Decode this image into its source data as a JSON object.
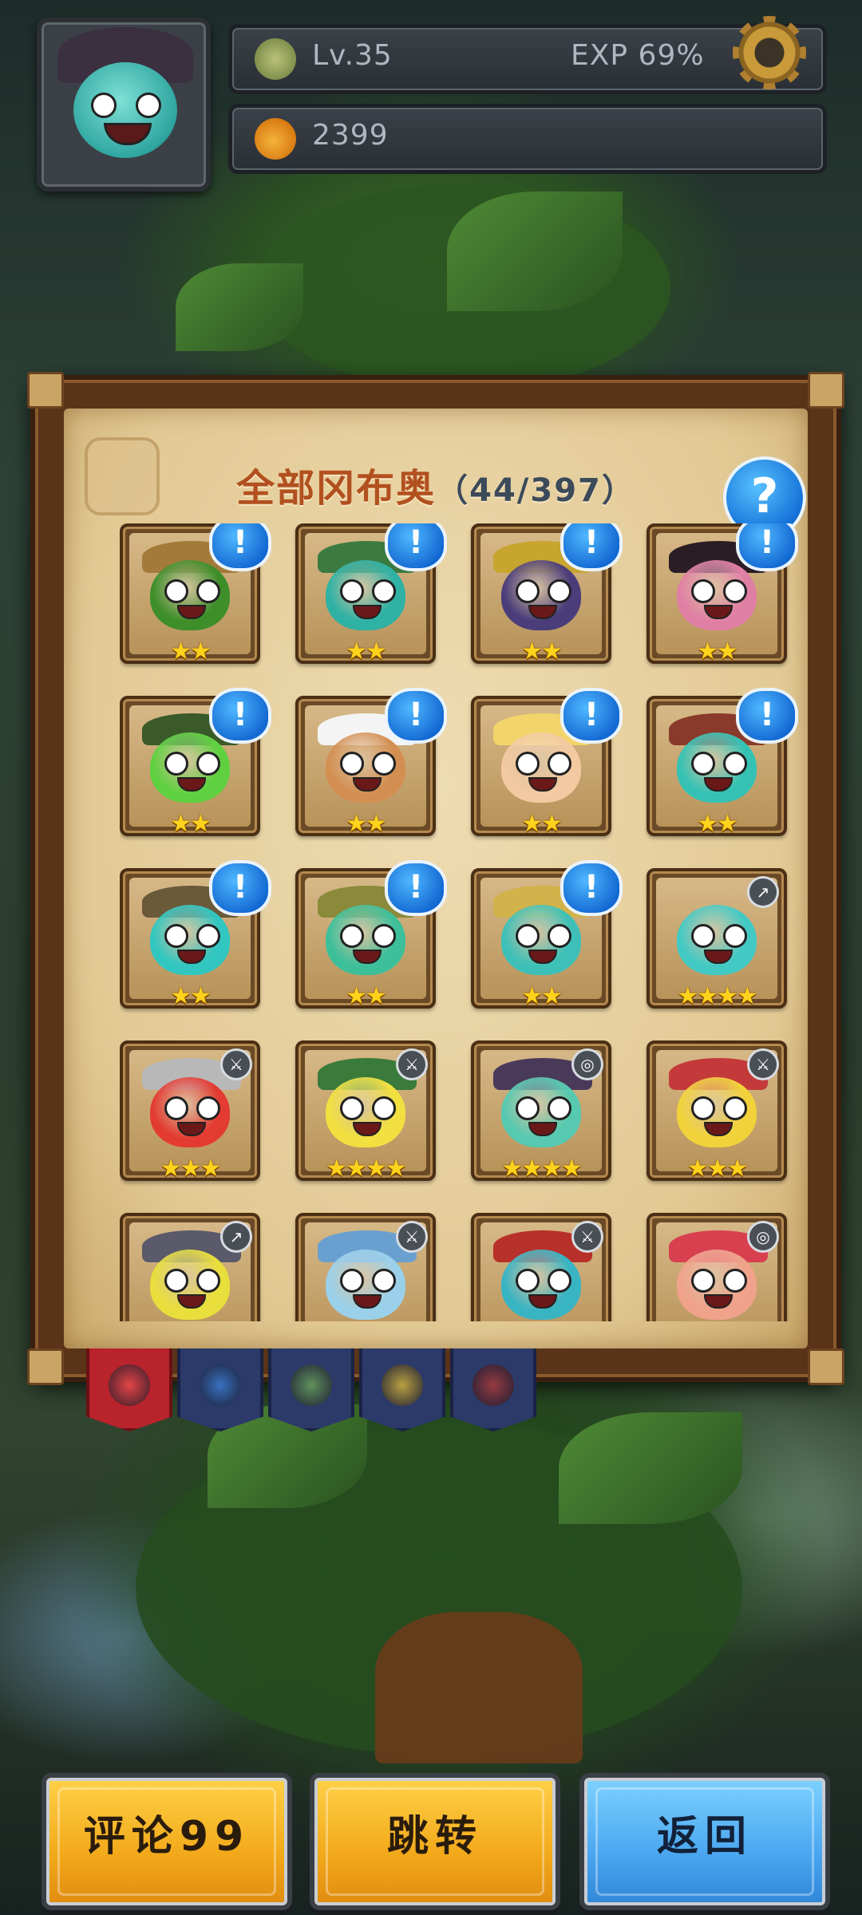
{
  "player": {
    "level": "Lv.35",
    "exp_label": "EXP 69%",
    "exp_percent": 69,
    "currency": "2399"
  },
  "collection": {
    "title": "全部冈布奥",
    "count": "（44/397）",
    "help_label": "?",
    "rows": [
      [
        {
          "name": "cactus-cowboy",
          "stars": "★★",
          "badge": "!",
          "body": "#3e8e2a",
          "hat": "#a37a3a"
        },
        {
          "name": "green-goggles",
          "stars": "★★",
          "badge": "!",
          "body": "#2fb1a4",
          "hat": "#3b7a40"
        },
        {
          "name": "robot-pilot",
          "stars": "★★",
          "badge": "!",
          "body": "#4a3d7a",
          "hat": "#c7a52e"
        },
        {
          "name": "samurai-girl",
          "stars": "★★",
          "badge": "!",
          "body": "#e07fa4",
          "hat": "#2a1d24"
        }
      ],
      [
        {
          "name": "tank-commander",
          "stars": "★★",
          "badge": "!",
          "body": "#5fd040",
          "hat": "#3a5a2a"
        },
        {
          "name": "chef",
          "stars": "★★",
          "badge": "!",
          "body": "#d38f52",
          "hat": "#f4f4f4"
        },
        {
          "name": "blond-knight",
          "stars": "★★",
          "badge": "!",
          "body": "#f2c9a0",
          "hat": "#f2d46a"
        },
        {
          "name": "elf-gunner",
          "stars": "★★",
          "badge": "!",
          "body": "#35c2b4",
          "hat": "#8a3a2a"
        }
      ],
      [
        {
          "name": "engineer",
          "stars": "★★",
          "badge": "!",
          "body": "#31c6c0",
          "hat": "#6a5a3a"
        },
        {
          "name": "gardener",
          "stars": "★★",
          "badge": "!",
          "body": "#3dbf9a",
          "hat": "#8a8a3a"
        },
        {
          "name": "golden-paladin",
          "stars": "★★",
          "badge": "!",
          "body": "#3ec0b8",
          "hat": "#d2b24a"
        },
        {
          "name": "basic-blue",
          "stars": "★★★★",
          "tiny": "↗",
          "body": "#43c9c4",
          "hat": ""
        }
      ],
      [
        {
          "name": "red-warrior",
          "stars": "★★★",
          "tiny": "⚔",
          "body": "#e33b32",
          "hat": "#b8b8b8"
        },
        {
          "name": "yellow-elf",
          "stars": "★★★★",
          "tiny": "⚔",
          "body": "#f1e040",
          "hat": "#3a7a3a"
        },
        {
          "name": "witch",
          "stars": "★★★★",
          "tiny": "◎",
          "body": "#57c9b0",
          "hat": "#4a3a5a"
        },
        {
          "name": "spartan",
          "stars": "★★★",
          "tiny": "⚔",
          "body": "#f2d23a",
          "hat": "#c43a3a"
        }
      ],
      [
        {
          "name": "yellow-armor",
          "stars": "",
          "tiny": "↗",
          "body": "#e8de3c",
          "hat": "#5a5a6a"
        },
        {
          "name": "ice-king",
          "stars": "",
          "tiny": "⚔",
          "body": "#9ad0ea",
          "hat": "#6aa0d0"
        },
        {
          "name": "pirate",
          "stars": "",
          "tiny": "⚔",
          "body": "#39b4c2",
          "hat": "#b8302a"
        },
        {
          "name": "crystal-shaman",
          "stars": "",
          "tiny": "◎",
          "body": "#f0a28a",
          "hat": "#d84050"
        }
      ]
    ]
  },
  "tabs": [
    {
      "name": "all",
      "color": "#e84a4a",
      "active": true
    },
    {
      "name": "blue",
      "color": "#3a7ad0",
      "active": false
    },
    {
      "name": "green",
      "color": "#6aa05a",
      "active": false
    },
    {
      "name": "yellow",
      "color": "#d2b23a",
      "active": false
    },
    {
      "name": "red",
      "color": "#a83a3a",
      "active": false
    }
  ],
  "buttons": {
    "comment": "评论99",
    "jump": "跳转",
    "back": "返回"
  },
  "colors": {
    "gold_button": "#f2a91a",
    "blue_button": "#4aa6f0",
    "badge_blue": "#1268d2",
    "title_orange": "#b2501f"
  }
}
